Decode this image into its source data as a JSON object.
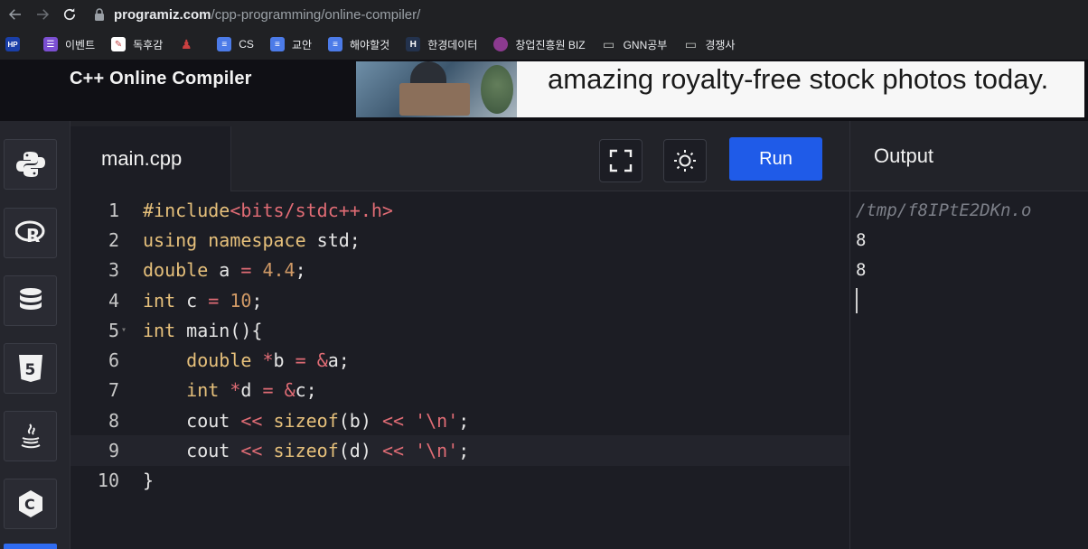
{
  "browser": {
    "url_host": "programiz.com",
    "url_path": "/cpp-programming/online-compiler/",
    "bookmarks": [
      {
        "icon": "HP",
        "label": "",
        "color": "#1a3fa8"
      },
      {
        "icon": "",
        "label": "이벤트",
        "color": "#7b4fd1"
      },
      {
        "icon": "",
        "label": "독후감",
        "color": "#c44848"
      },
      {
        "icon": "",
        "label": "",
        "color": "#c94040"
      },
      {
        "icon": "",
        "label": "CS",
        "color": "#4c7be8"
      },
      {
        "icon": "",
        "label": "교안",
        "color": "#4c7be8"
      },
      {
        "icon": "",
        "label": "해야할것",
        "color": "#4c7be8"
      },
      {
        "icon": "H",
        "label": "한경데이터",
        "color": "#23324d"
      },
      {
        "icon": "",
        "label": "창업진흥원 BIZ",
        "color": "#8b3a8f"
      },
      {
        "icon": "",
        "label": "GNN공부",
        "color": "#202124"
      },
      {
        "icon": "",
        "label": "경쟁사",
        "color": "#202124"
      }
    ]
  },
  "app": {
    "title": "C++ Online Compiler",
    "ad_text": "amazing royalty-free stock photos today."
  },
  "sidebar": {
    "languages": [
      "python-icon",
      "r-icon",
      "sql-icon",
      "html5-icon",
      "java-icon",
      "c-icon"
    ]
  },
  "editor": {
    "filename": "main.cpp",
    "run_label": "Run",
    "lines": [
      {
        "n": "1"
      },
      {
        "n": "2"
      },
      {
        "n": "3"
      },
      {
        "n": "4"
      },
      {
        "n": "5"
      },
      {
        "n": "6"
      },
      {
        "n": "7"
      },
      {
        "n": "8"
      },
      {
        "n": "9"
      },
      {
        "n": "10"
      }
    ],
    "code": {
      "l1a": "#include",
      "l1b": "<bits/stdc++.h>",
      "l2a": "using namespace",
      "l2b": " std;",
      "l3a": "double",
      "l3b": " a ",
      "l3c": "=",
      "l3d": " 4.4",
      "l3e": ";",
      "l4a": "int",
      "l4b": " c ",
      "l4c": "=",
      "l4d": " 10",
      "l4e": ";",
      "l5a": "int",
      "l5b": " main(){",
      "l6a": "    double",
      "l6b": " *",
      "l6c": "b ",
      "l6d": "=",
      "l6e": " &",
      "l6f": "a;",
      "l7a": "    int",
      "l7b": " *",
      "l7c": "d ",
      "l7d": "=",
      "l7e": " &",
      "l7f": "c;",
      "l8a": "    cout ",
      "l8b": "<<",
      "l8c": " sizeof",
      "l8d": "(b) ",
      "l8e": "<<",
      "l8f": " '\\n'",
      "l8g": ";",
      "l9a": "    cout ",
      "l9b": "<<",
      "l9c": " sizeof",
      "l9d": "(d) ",
      "l9e": "<<",
      "l9f": " '\\n'",
      "l9g": ";",
      "l10a": "}"
    }
  },
  "output": {
    "heading": "Output",
    "path": "/tmp/f8IPtE2DKn.o",
    "lines": [
      "8",
      "8"
    ]
  }
}
